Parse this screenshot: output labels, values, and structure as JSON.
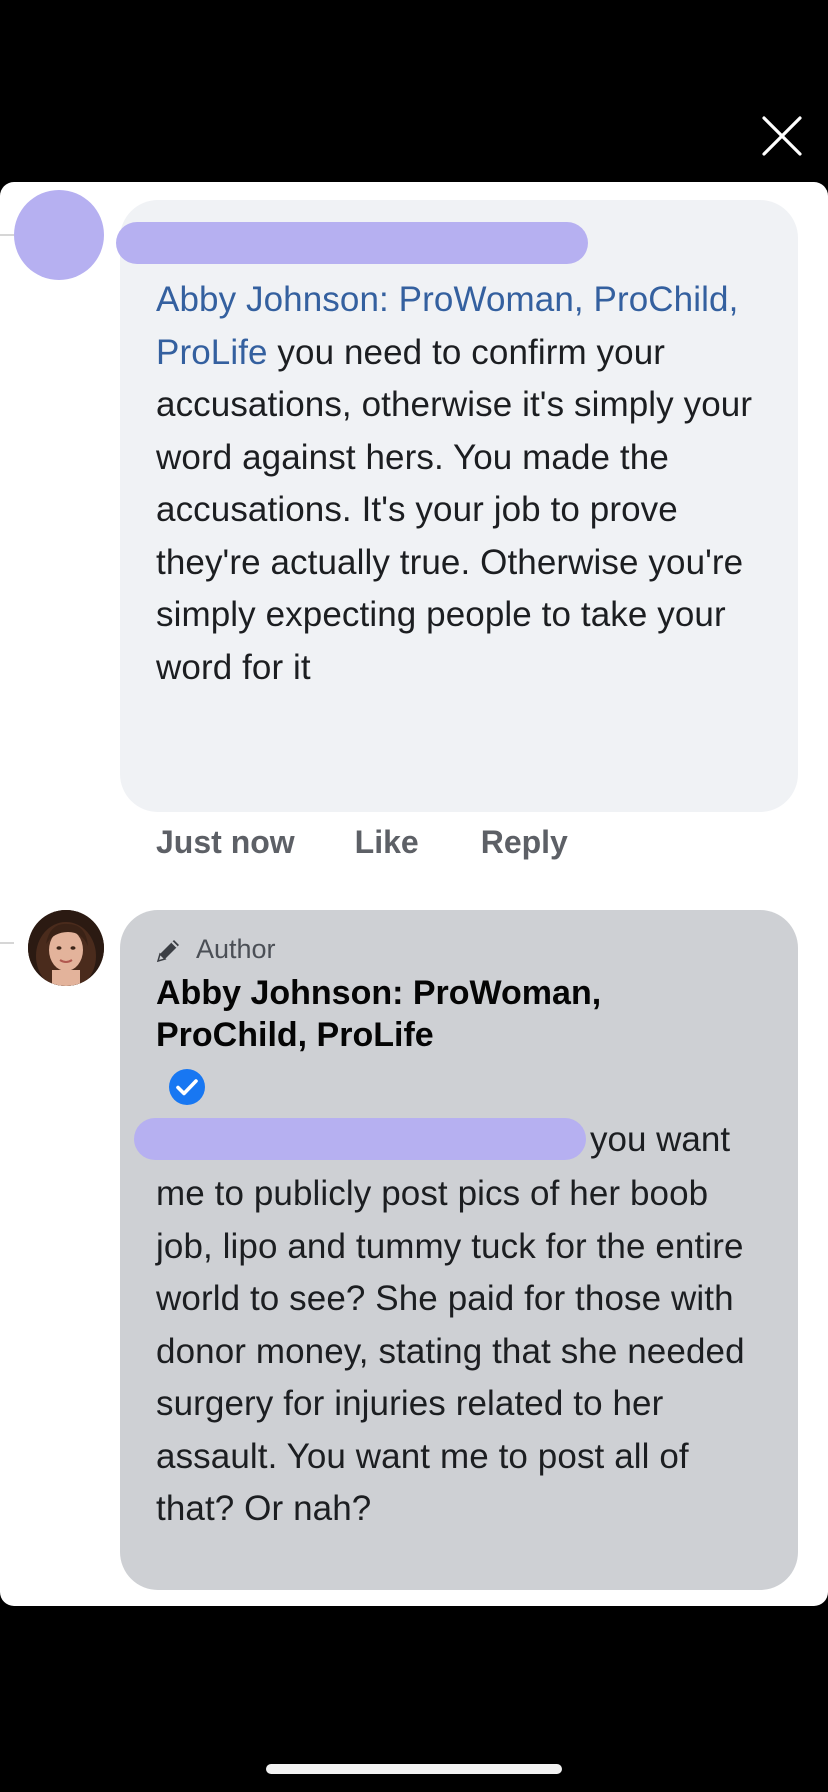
{
  "icons": {
    "close": "close-icon",
    "pencil": "pencil-icon",
    "verified": "verified-badge-icon"
  },
  "colors": {
    "redaction": "#b6b0f1",
    "mention": "#34609f",
    "comment_bubble": "#f0f2f5",
    "author_bubble": "#ced0d4"
  },
  "comment1": {
    "mention": "Abby Johnson: ProWoman, ProChild, ProLife",
    "text": " you need to confirm your accusations, otherwise it's simply your word against hers. You made the accusations. It's your job to prove they're actually true. Otherwise you're simply expecting people to take your word for it",
    "actions": {
      "time": "Just now",
      "like": "Like",
      "reply": "Reply"
    }
  },
  "comment2": {
    "badge": "Author",
    "author": "Abby Johnson: ProWoman, ProChild, ProLife",
    "first_line": "you want",
    "text": "me to publicly post pics of her boob job, lipo and tummy tuck for the entire world to see? She paid for those with donor money, stating that she needed surgery for injuries related to her assault. You want me to post all of that? Or nah?"
  }
}
